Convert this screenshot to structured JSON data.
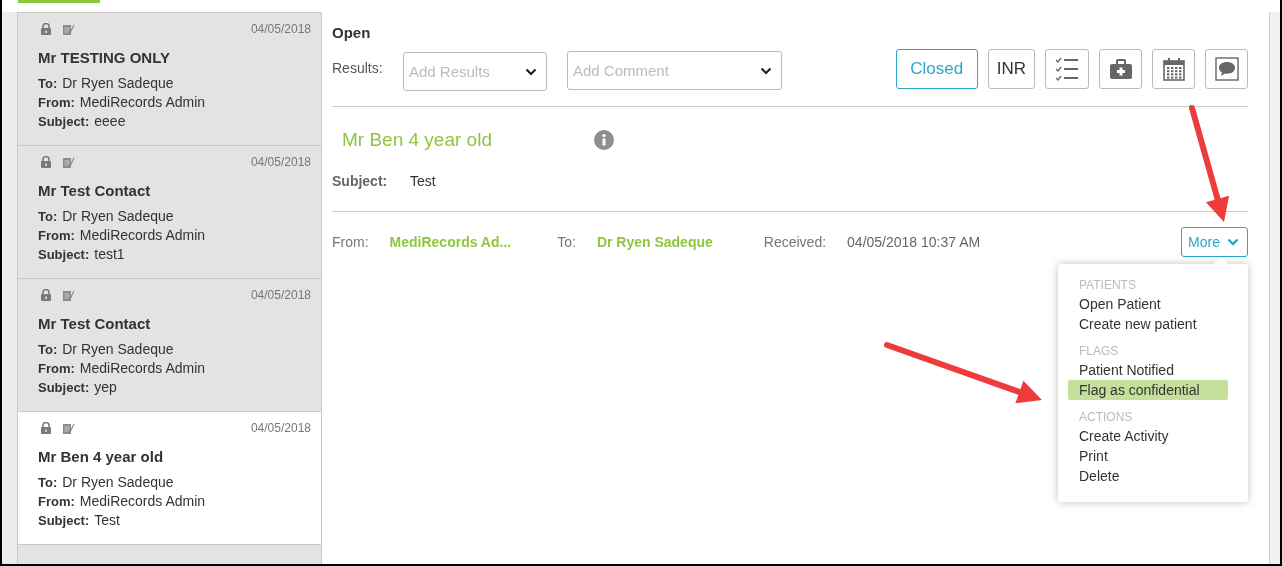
{
  "messages": [
    {
      "date": "04/05/2018",
      "name": "Mr TESTING ONLY",
      "to_label": "To:",
      "to": "Dr Ryen Sadeque",
      "from_label": "From:",
      "from": "MediRecords Admin",
      "subject_label": "Subject:",
      "subject": "eeee",
      "selected": false
    },
    {
      "date": "04/05/2018",
      "name": "Mr Test Contact",
      "to_label": "To:",
      "to": "Dr Ryen Sadeque",
      "from_label": "From:",
      "from": "MediRecords Admin",
      "subject_label": "Subject:",
      "subject": "test1",
      "selected": false
    },
    {
      "date": "04/05/2018",
      "name": "Mr Test Contact",
      "to_label": "To:",
      "to": "Dr Ryen Sadeque",
      "from_label": "From:",
      "from": "MediRecords Admin",
      "subject_label": "Subject:",
      "subject": "yep",
      "selected": false
    },
    {
      "date": "04/05/2018",
      "name": "Mr Ben 4 year old",
      "to_label": "To:",
      "to": "Dr Ryen Sadeque",
      "from_label": "From:",
      "from": "MediRecords Admin",
      "subject_label": "Subject:",
      "subject": "Test",
      "selected": true
    }
  ],
  "detail": {
    "status": "Open",
    "results_label": "Results:",
    "results_field": {
      "placeholder": "Add Results"
    },
    "comment_field": {
      "placeholder": "Add Comment"
    },
    "toolbar": [
      {
        "kind": "status",
        "label": "Closed"
      },
      {
        "kind": "text",
        "label": "INR"
      },
      {
        "kind": "checklist"
      },
      {
        "kind": "medkit"
      },
      {
        "kind": "calendar"
      },
      {
        "kind": "sms"
      }
    ],
    "title": "Mr Ben 4 year old",
    "subject_label": "Subject:",
    "subject": "Test",
    "from_label": "From:",
    "from": "MediRecords Ad...",
    "to_label": "To:",
    "to": "Dr Ryen Sadeque",
    "received_label": "Received:",
    "received": "04/05/2018 10:37 AM",
    "more_button": {
      "label": "More",
      "expanded": true
    },
    "more_menu": [
      {
        "heading": "PATIENTS",
        "items": [
          {
            "label": "Open Patient",
            "selected": false
          },
          {
            "label": "Create new patient",
            "selected": false
          }
        ]
      },
      {
        "heading": "FLAGS",
        "items": [
          {
            "label": "Patient Notified",
            "selected": false
          },
          {
            "label": "Flag as confidential",
            "selected": true
          }
        ]
      },
      {
        "heading": "ACTIONS",
        "items": [
          {
            "label": "Create Activity",
            "selected": false
          },
          {
            "label": "Print",
            "selected": false
          },
          {
            "label": "Delete",
            "selected": false
          }
        ]
      }
    ]
  },
  "annotation_arrows": [
    {
      "kind": "arrow"
    },
    {
      "kind": "arrow"
    }
  ]
}
